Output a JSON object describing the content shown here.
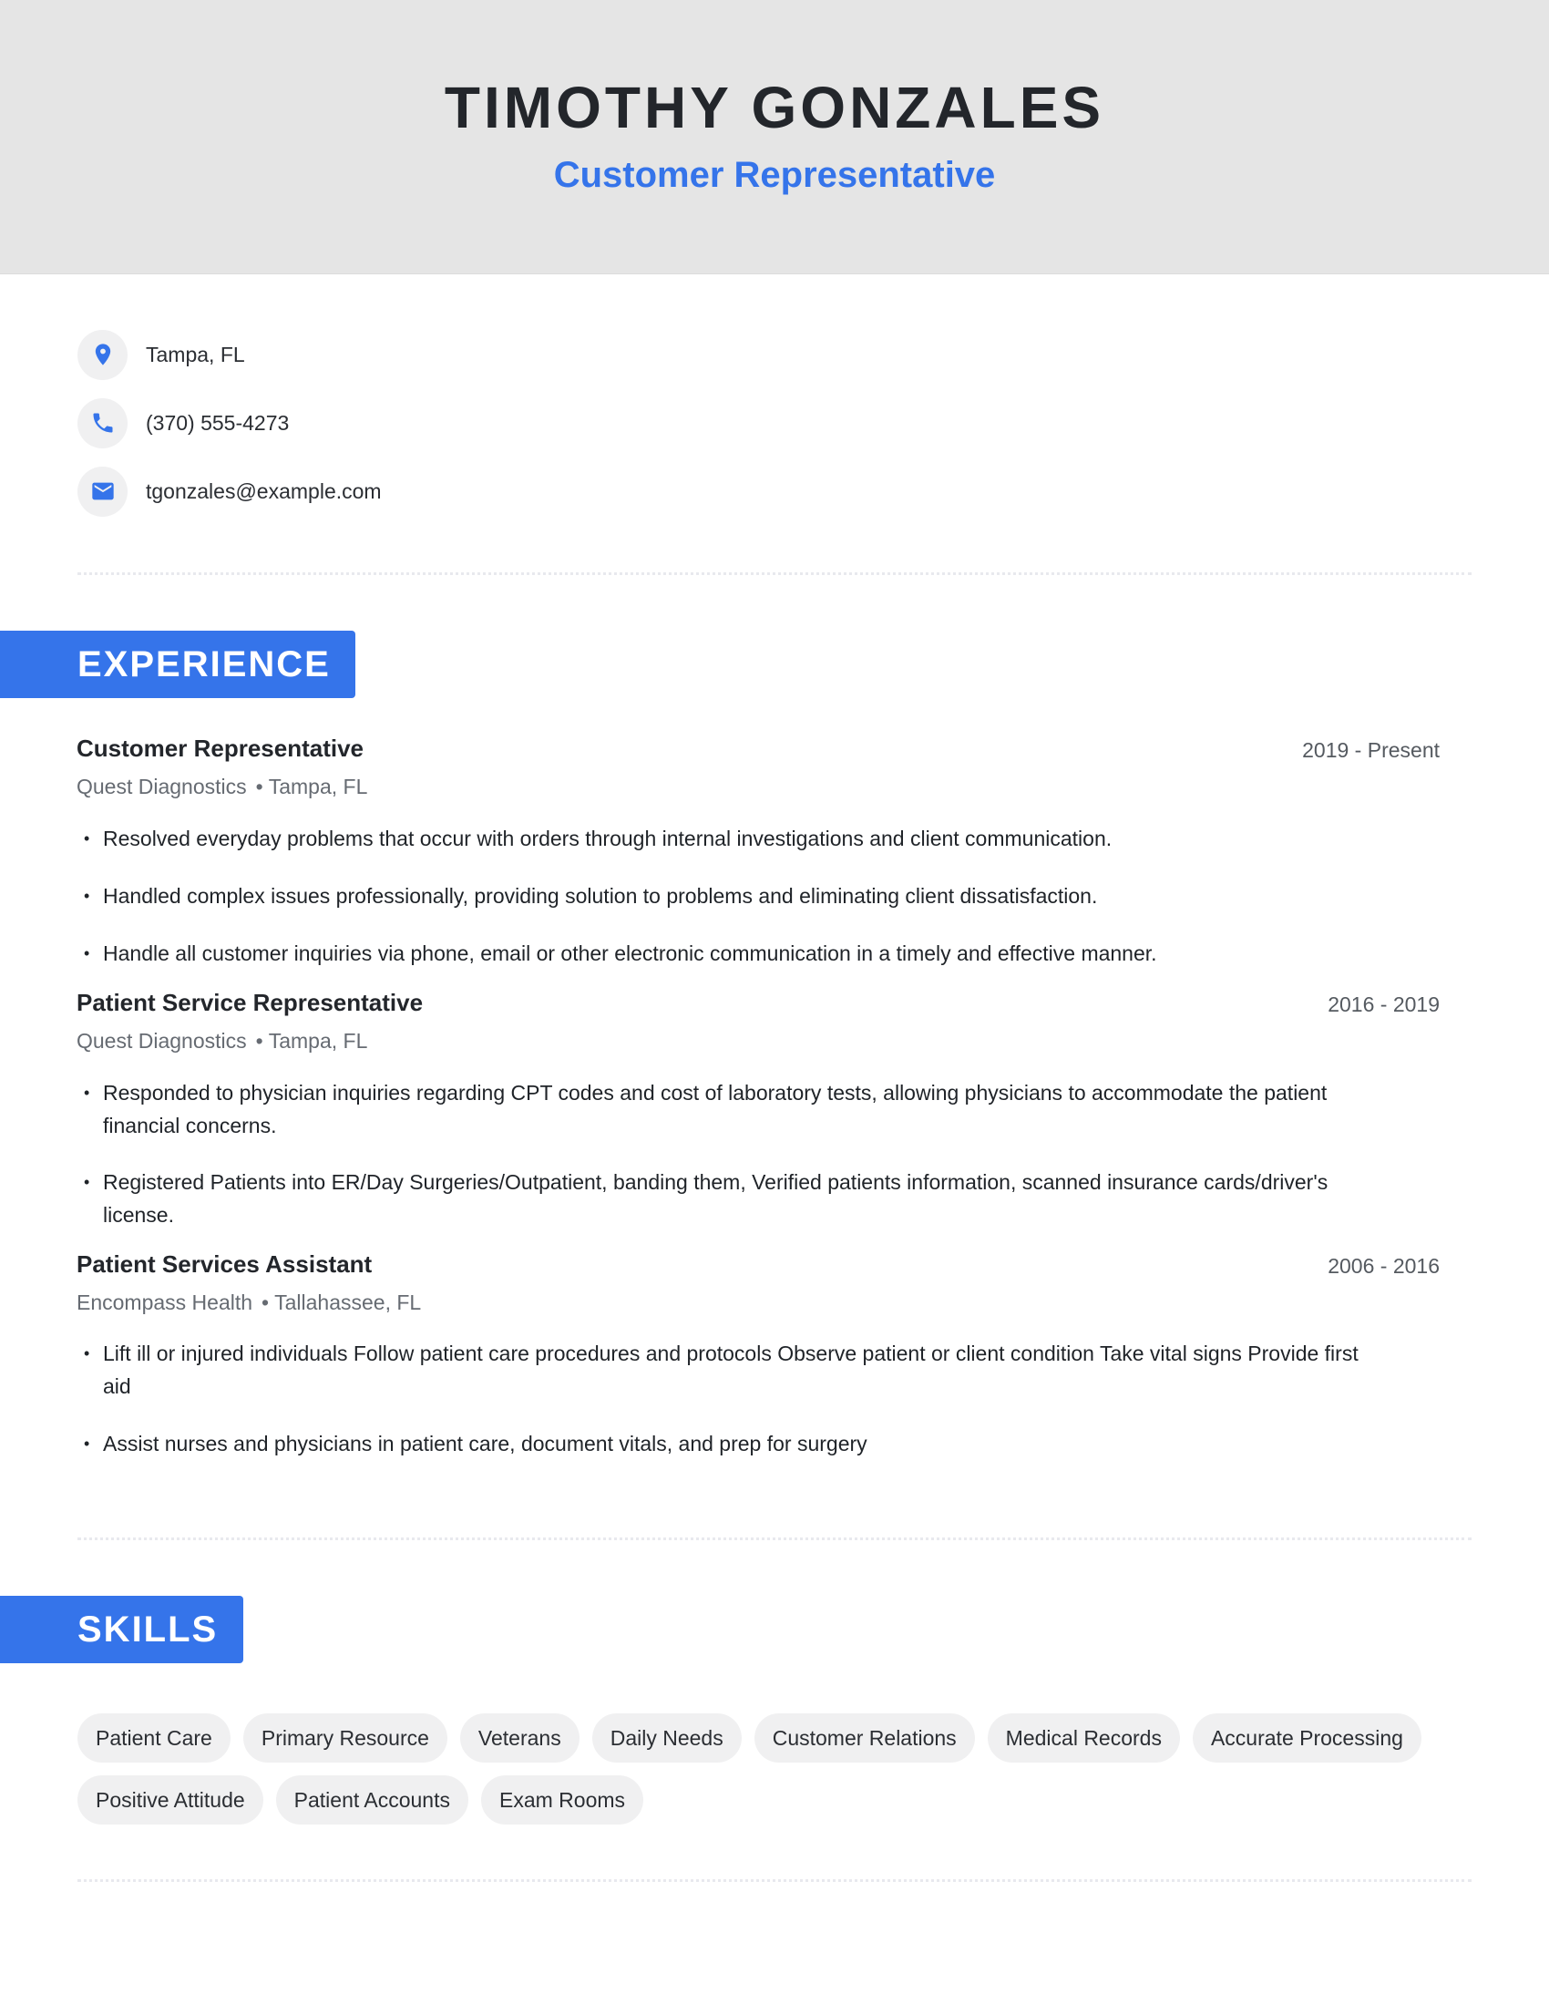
{
  "header": {
    "name": "TIMOTHY GONZALES",
    "title": "Customer Representative",
    "background_color": "#e5e5e5",
    "accent_color": "#3574ea"
  },
  "contact": [
    {
      "icon": "location-pin-icon",
      "text": "Tampa, FL"
    },
    {
      "icon": "phone-icon",
      "text": "(370) 555-4273"
    },
    {
      "icon": "email-icon",
      "text": "tgonzales@example.com"
    }
  ],
  "sections": {
    "experience": "EXPERIENCE",
    "skills": "SKILLS"
  },
  "experience": [
    {
      "title": "Customer Representative",
      "dates": "2019 - Present",
      "company": "Quest Diagnostics",
      "location": "Tampa, FL",
      "bullets": [
        "Resolved everyday problems that occur with orders through internal investigations and client communication.",
        "Handled complex issues professionally, providing solution to problems and eliminating client dissatisfaction.",
        "Handle all customer inquiries via phone, email or other electronic communication in a timely and effective manner."
      ]
    },
    {
      "title": "Patient Service Representative",
      "dates": "2016 - 2019",
      "company": "Quest Diagnostics",
      "location": "Tampa, FL",
      "bullets": [
        "Responded to physician inquiries regarding CPT codes and cost of laboratory tests, allowing physicians to accommodate the patient financial concerns.",
        "Registered Patients into ER/Day Surgeries/Outpatient, banding them, Verified patients information, scanned insurance cards/driver's license."
      ]
    },
    {
      "title": "Patient Services Assistant",
      "dates": "2006 - 2016",
      "company": "Encompass Health",
      "location": "Tallahassee, FL",
      "bullets": [
        "Lift ill or injured individuals Follow patient care procedures and protocols Observe patient or client condition Take vital signs Provide first aid",
        "Assist nurses and physicians in patient care, document vitals, and prep for surgery"
      ]
    }
  ],
  "separator": "•",
  "bullet_mark": "•",
  "skills": [
    "Patient Care",
    "Primary Resource",
    "Veterans",
    "Daily Needs",
    "Customer Relations",
    "Medical Records",
    "Accurate Processing",
    "Positive Attitude",
    "Patient Accounts",
    "Exam Rooms"
  ]
}
